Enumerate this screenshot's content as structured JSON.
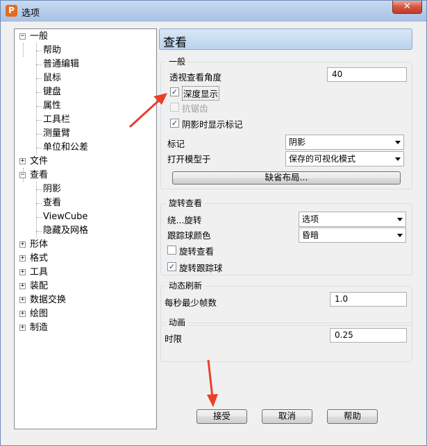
{
  "window": {
    "title": "选项",
    "close_glyph": "✕",
    "app_icon_letter": "P"
  },
  "tree": {
    "nodes": [
      {
        "label": "一般",
        "expander": "−",
        "children": [
          "帮助",
          "普通编辑",
          "鼠标",
          "键盘",
          "属性",
          "工具栏",
          "测量臂",
          "单位和公差"
        ]
      },
      {
        "label": "文件",
        "expander": "+"
      },
      {
        "label": "查看",
        "expander": "−",
        "children": [
          "阴影",
          "查看",
          "ViewCube",
          "隐藏及网格"
        ]
      },
      {
        "label": "形体",
        "expander": "+"
      },
      {
        "label": "格式",
        "expander": "+"
      },
      {
        "label": "工具",
        "expander": "+"
      },
      {
        "label": "装配",
        "expander": "+"
      },
      {
        "label": "数据交换",
        "expander": "+"
      },
      {
        "label": "绘图",
        "expander": "+"
      },
      {
        "label": "制造",
        "expander": "+"
      }
    ]
  },
  "panel": {
    "title": "查看",
    "general": {
      "title": "一般",
      "perspective_label": "透视查看角度",
      "perspective_value": "40",
      "depth_display": {
        "label": "深度显示",
        "checked": true
      },
      "antialias": {
        "label": "抗锯齿",
        "checked": false,
        "disabled": true
      },
      "shadow_marker": {
        "label": "阴影时显示标记",
        "checked": true
      },
      "marker_label": "标记",
      "marker_value": "阴影",
      "open_model_label": "打开模型于",
      "open_model_value": "保存的可视化模式",
      "default_layout_button": "缺省布局..."
    },
    "rotate": {
      "title": "旋转查看",
      "rotate_about_label": "绕...旋转",
      "rotate_about_value": "选项",
      "trackball_color_label": "跟踪球颜色",
      "trackball_color_value": "昏暗",
      "rotate_view": {
        "label": "旋转查看",
        "checked": false
      },
      "rotate_trackball": {
        "label": "旋转跟踪球",
        "checked": true
      }
    },
    "refresh": {
      "title": "动态刷新",
      "min_fps_label": "每秒最少帧数",
      "min_fps_value": "1.0"
    },
    "animation": {
      "title": "动画",
      "duration_label": "时限",
      "duration_value": "0.25"
    }
  },
  "footer": {
    "accept": "接受",
    "cancel": "取消",
    "help": "帮助"
  },
  "colors": {
    "annotation_arrow": "#e8402a"
  }
}
